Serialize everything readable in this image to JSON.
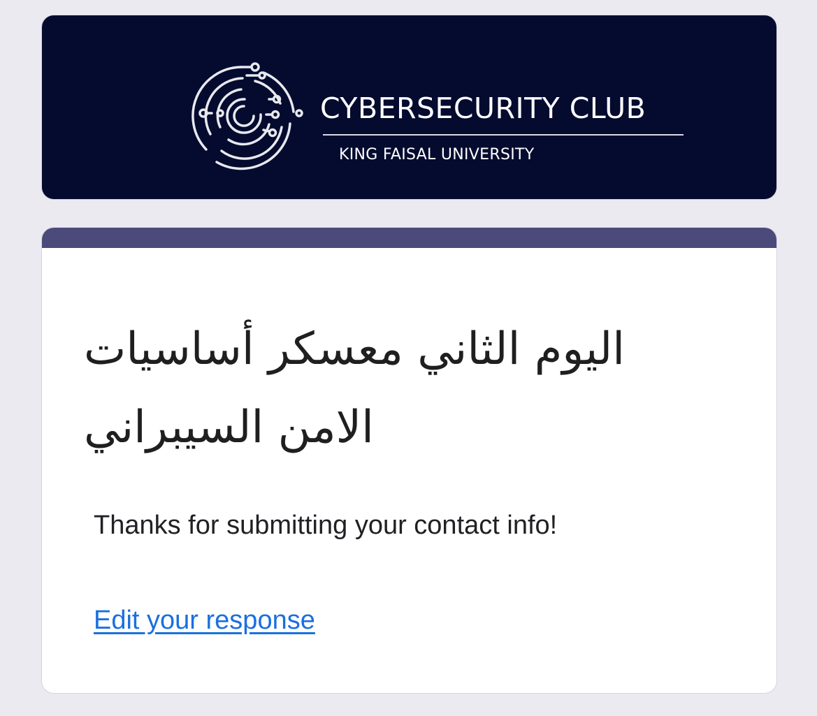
{
  "header": {
    "logo_title": "CYBERSECURITY CLUB",
    "logo_subtitle": "KING FAISAL UNIVERSITY",
    "background_color": "#050b2f",
    "logo_icon": "circuit-ring-icon"
  },
  "form": {
    "accent_color": "#4c4a7a",
    "title": "اليوم الثاني معسكر أساسيات الامن السيبراني",
    "confirmation_message": "Thanks for submitting your contact info!",
    "edit_link_label": "Edit your response",
    "link_color": "#1a6fe0"
  }
}
